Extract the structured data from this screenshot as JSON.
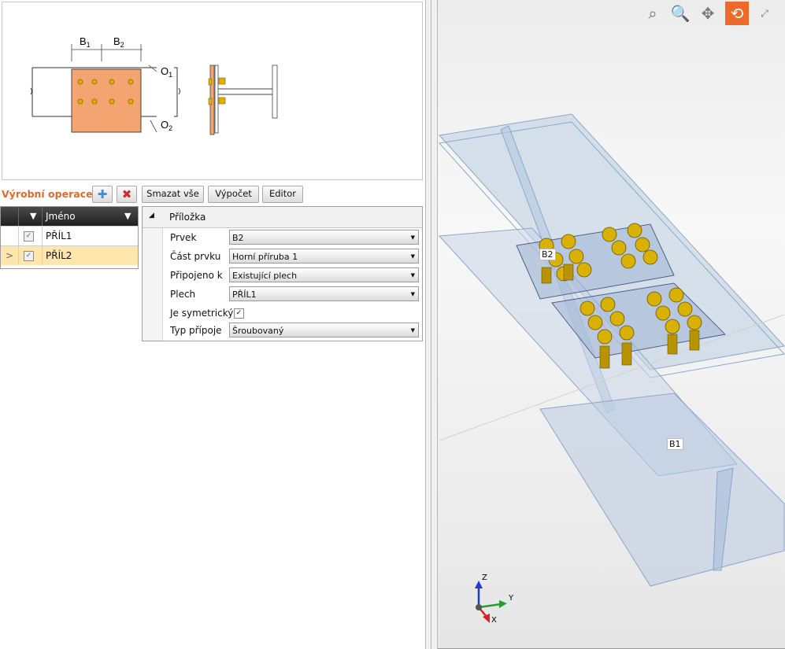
{
  "preview": {
    "labels": {
      "b1": "B",
      "b1_sub": "1",
      "b2": "B",
      "b2_sub": "2",
      "o1": "O",
      "o1_sub": "1",
      "o2": "O",
      "o2_sub": "2"
    },
    "colors": {
      "plate": "#f4a471",
      "bolt": "#e0b000",
      "line": "#333333"
    }
  },
  "toolbar": {
    "title": "Výrobní operace",
    "add_icon": "plus-icon",
    "delete_icon": "x-icon",
    "delete_all_label": "Smazat vše",
    "calc_label": "Výpočet",
    "editor_label": "Editor"
  },
  "grid": {
    "header_name": "Jméno",
    "rows": [
      {
        "name": "PŘÍL1",
        "checked": true,
        "selected": false,
        "arrow": ""
      },
      {
        "name": "PŘÍL2",
        "checked": true,
        "selected": true,
        "arrow": ">"
      }
    ]
  },
  "props": {
    "section": "Příložka",
    "rows": [
      {
        "label": "Prvek",
        "value": "B2"
      },
      {
        "label": "Část prvku",
        "value": "Horní příruba 1"
      },
      {
        "label": "Připojeno k",
        "value": "Existující plech"
      },
      {
        "label": "Plech",
        "value": "PŘÍL1"
      },
      {
        "label": "Je symetrický",
        "checkbox": true
      },
      {
        "label": "Typ přípoje",
        "value": "Šroubovaný"
      }
    ]
  },
  "viewport": {
    "tools": [
      "zoom-window-icon",
      "zoom-icon",
      "pan-icon",
      "rotate-icon",
      "zoom-extents-icon"
    ],
    "label_b2": "B2",
    "label_b1": "B1",
    "axis_z": "Z",
    "axis_y": "Y",
    "axis_x": "X",
    "colors": {
      "accent": "#ee6a2b",
      "beam": "#b8cce4",
      "bolt": "#d9b100"
    }
  }
}
